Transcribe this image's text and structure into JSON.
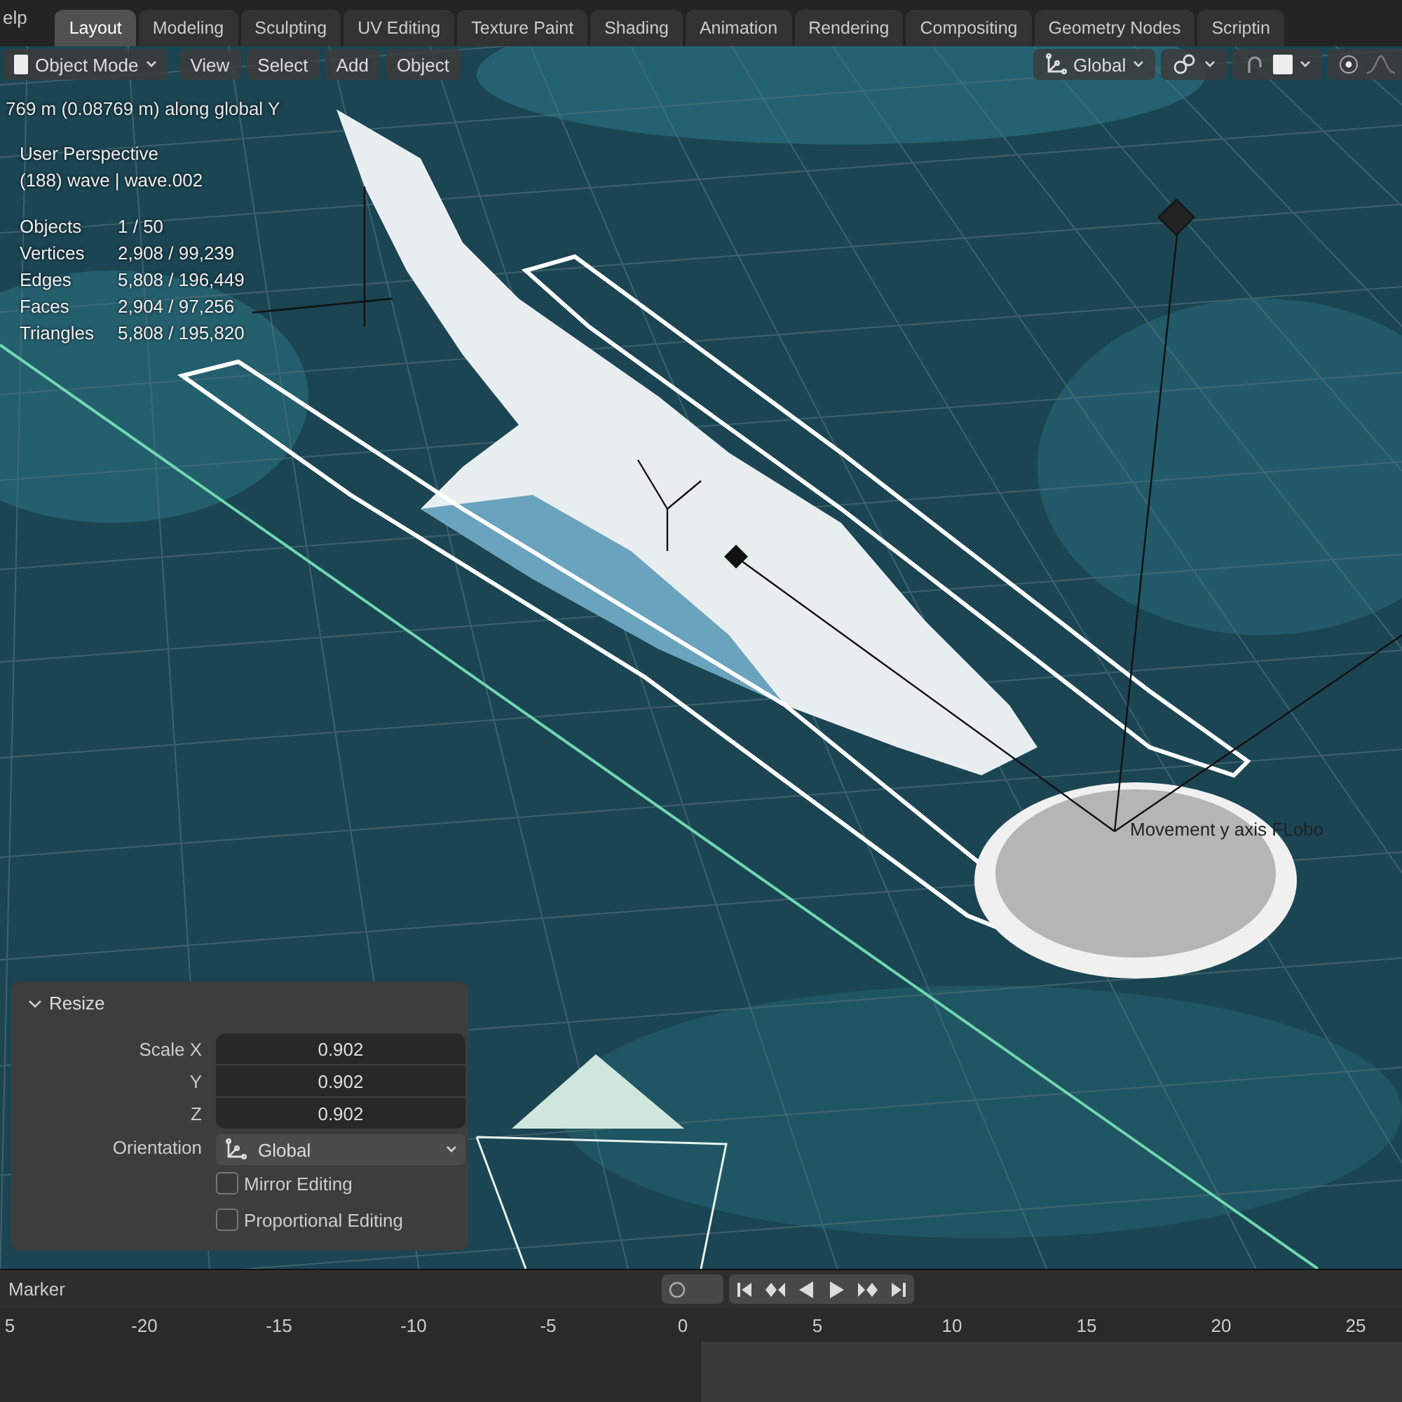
{
  "menu": {
    "partial_label": "elp"
  },
  "workspace_tabs": [
    {
      "label": "Layout",
      "selected": true
    },
    {
      "label": "Modeling",
      "selected": false
    },
    {
      "label": "Sculpting",
      "selected": false
    },
    {
      "label": "UV Editing",
      "selected": false
    },
    {
      "label": "Texture Paint",
      "selected": false
    },
    {
      "label": "Shading",
      "selected": false
    },
    {
      "label": "Animation",
      "selected": false
    },
    {
      "label": "Rendering",
      "selected": false
    },
    {
      "label": "Compositing",
      "selected": false
    },
    {
      "label": "Geometry Nodes",
      "selected": false
    },
    {
      "label": "Scriptin",
      "selected": false
    }
  ],
  "viewport_header": {
    "mode": "Object Mode",
    "menus": [
      "View",
      "Select",
      "Add",
      "Object"
    ],
    "orientation": "Global",
    "proportional_editing_on": false
  },
  "viewport": {
    "operator_status": "769 m (0.08769 m) along global Y",
    "view_name": "User Perspective",
    "object_info": "(188) wave | wave.002",
    "stats": [
      {
        "label": "Objects",
        "value": "1 / 50"
      },
      {
        "label": "Vertices",
        "value": "2,908 / 99,239"
      },
      {
        "label": "Edges",
        "value": "5,808 / 196,449"
      },
      {
        "label": "Faces",
        "value": "2,904 / 97,256"
      },
      {
        "label": "Triangles",
        "value": "5,808 / 195,820"
      }
    ],
    "object_label": "Movement y axis FLobo"
  },
  "resize_panel": {
    "title": "Resize",
    "expanded": true,
    "scale": [
      {
        "label": "Scale X",
        "value": "0.902"
      },
      {
        "label": "Y",
        "value": "0.902"
      },
      {
        "label": "Z",
        "value": "0.902"
      }
    ],
    "orientation_label": "Orientation",
    "orientation_value": "Global",
    "options": [
      {
        "label": "Mirror Editing",
        "checked": false
      },
      {
        "label": "Proportional Editing",
        "checked": false
      }
    ]
  },
  "timeline": {
    "menu": "Marker",
    "ticks": [
      "5",
      "-20",
      "-15",
      "-10",
      "-5",
      "0",
      "5",
      "10",
      "15",
      "20",
      "25"
    ]
  }
}
